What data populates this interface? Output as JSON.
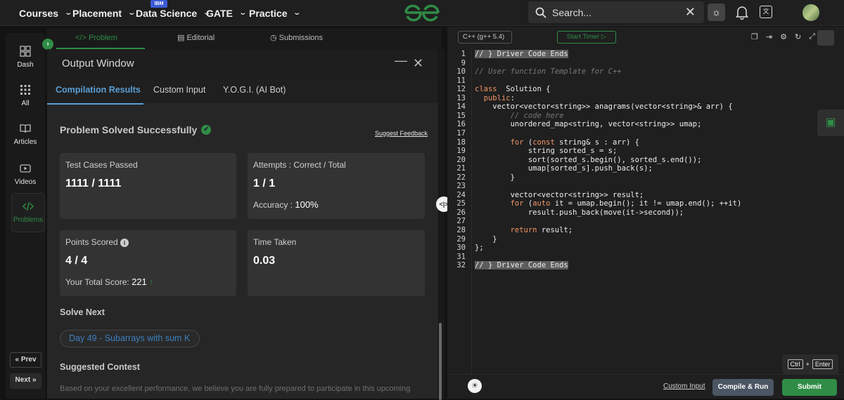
{
  "topnav": {
    "items": [
      {
        "label": "Courses"
      },
      {
        "label": "Placement"
      },
      {
        "label": "Data Science"
      },
      {
        "label": "GATE"
      },
      {
        "label": "Practice"
      }
    ],
    "ibm_badge": "IBM",
    "search_placeholder": "Search..."
  },
  "sidebar": {
    "items": [
      {
        "label": "Dash",
        "icon": "dashboard-icon"
      },
      {
        "label": "All",
        "icon": "grid-icon"
      },
      {
        "label": "Articles",
        "icon": "book-icon"
      },
      {
        "label": "Videos",
        "icon": "video-icon"
      },
      {
        "label": "Problems",
        "icon": "code-icon"
      }
    ],
    "prev": "Prev",
    "next": "Next"
  },
  "problem_tabs": [
    {
      "label": "Problem"
    },
    {
      "label": "Editorial"
    },
    {
      "label": "Submissions"
    }
  ],
  "output": {
    "title": "Output Window",
    "tabs": [
      "Compilation Results",
      "Custom Input",
      "Y.O.G.I. (AI Bot)"
    ],
    "status": "Problem Solved Successfully",
    "feedback": "Suggest Feedback",
    "cards": {
      "tests_label": "Test Cases Passed",
      "tests_value": "1111 / 1111",
      "attempts_label": "Attempts : Correct / Total",
      "attempts_value": "1 / 1",
      "accuracy_label": "Accuracy :",
      "accuracy_value": "100%",
      "points_label": "Points Scored",
      "points_value": "4 / 4",
      "total_label": "Your Total Score:",
      "total_value": "221",
      "time_label": "Time Taken",
      "time_value": "0.03"
    },
    "solve_next_title": "Solve Next",
    "solve_next_item": "Day 49 - Subarrays with sum K",
    "contest_title": "Suggested Contest",
    "contest_desc": "Based on your excellent performance, we believe you are fully prepared to participate in this upcoming"
  },
  "editor": {
    "language": "C++ (g++ 5.4)",
    "timer": "Start Timer",
    "lines": [
      {
        "n": "1",
        "segs": [
          [
            "hl",
            "// } Driver Code Ends"
          ]
        ]
      },
      {
        "n": "9",
        "segs": []
      },
      {
        "n": "10",
        "segs": [
          [
            "cm",
            "// User function Template for C++"
          ]
        ]
      },
      {
        "n": "11",
        "segs": []
      },
      {
        "n": "12",
        "segs": [
          [
            "kw",
            "class"
          ],
          [
            "",
            "  Solution {"
          ]
        ]
      },
      {
        "n": "13",
        "segs": [
          [
            "",
            "  "
          ],
          [
            "kw",
            "public"
          ],
          [
            "",
            ":"
          ]
        ]
      },
      {
        "n": "14",
        "segs": [
          [
            "",
            "    vector<vector<string>> anagrams(vector<string>& arr) {"
          ]
        ]
      },
      {
        "n": "15",
        "segs": [
          [
            "",
            "        "
          ],
          [
            "cm",
            "// code here"
          ]
        ]
      },
      {
        "n": "16",
        "segs": [
          [
            "",
            "        unordered_map<string, vector<string>> umap;"
          ]
        ]
      },
      {
        "n": "17",
        "segs": []
      },
      {
        "n": "18",
        "segs": [
          [
            "",
            "        "
          ],
          [
            "kw",
            "for"
          ],
          [
            "",
            " ("
          ],
          [
            "kw",
            "const"
          ],
          [
            "",
            "",
            " string& s : arr) {"
          ]
        ]
      },
      {
        "n": "19",
        "segs": [
          [
            "",
            "            string sorted_s = s;"
          ]
        ]
      },
      {
        "n": "20",
        "segs": [
          [
            "",
            "            sort(sorted_s.begin(), sorted_s.end());"
          ]
        ]
      },
      {
        "n": "21",
        "segs": [
          [
            "",
            "            umap[sorted_s].push_back(s);"
          ]
        ]
      },
      {
        "n": "22",
        "segs": [
          [
            "",
            "        }"
          ]
        ]
      },
      {
        "n": "23",
        "segs": []
      },
      {
        "n": "24",
        "segs": [
          [
            "",
            "        vector<vector<string>> result;"
          ]
        ]
      },
      {
        "n": "25",
        "segs": [
          [
            "",
            "        "
          ],
          [
            "kw",
            "for"
          ],
          [
            "",
            "",
            " ("
          ],
          [
            "kw",
            "auto"
          ],
          [
            "",
            "",
            " it = umap.begin(); it != umap.end(); ++it)"
          ]
        ]
      },
      {
        "n": "26",
        "segs": [
          [
            "",
            "            result.push_back(move(it->second));"
          ]
        ]
      },
      {
        "n": "27",
        "segs": []
      },
      {
        "n": "28",
        "segs": [
          [
            "",
            "        "
          ],
          [
            "kw",
            "return"
          ],
          [
            "",
            "",
            " result;"
          ]
        ]
      },
      {
        "n": "29",
        "segs": [
          [
            "",
            "    }"
          ]
        ]
      },
      {
        "n": "30",
        "segs": [
          [
            "",
            "};"
          ]
        ]
      },
      {
        "n": "31",
        "segs": []
      },
      {
        "n": "32",
        "segs": [
          [
            "hl",
            "// } Driver Code Ends"
          ]
        ]
      }
    ],
    "keys": [
      "Ctrl",
      "+",
      "Enter"
    ],
    "custom_input": "Custom Input",
    "compile_run": "Compile & Run",
    "submit": "Submit"
  },
  "colors": {
    "accent_green": "#2f8d46",
    "link_blue": "#5a9fd6",
    "keyword": "#f29668"
  }
}
